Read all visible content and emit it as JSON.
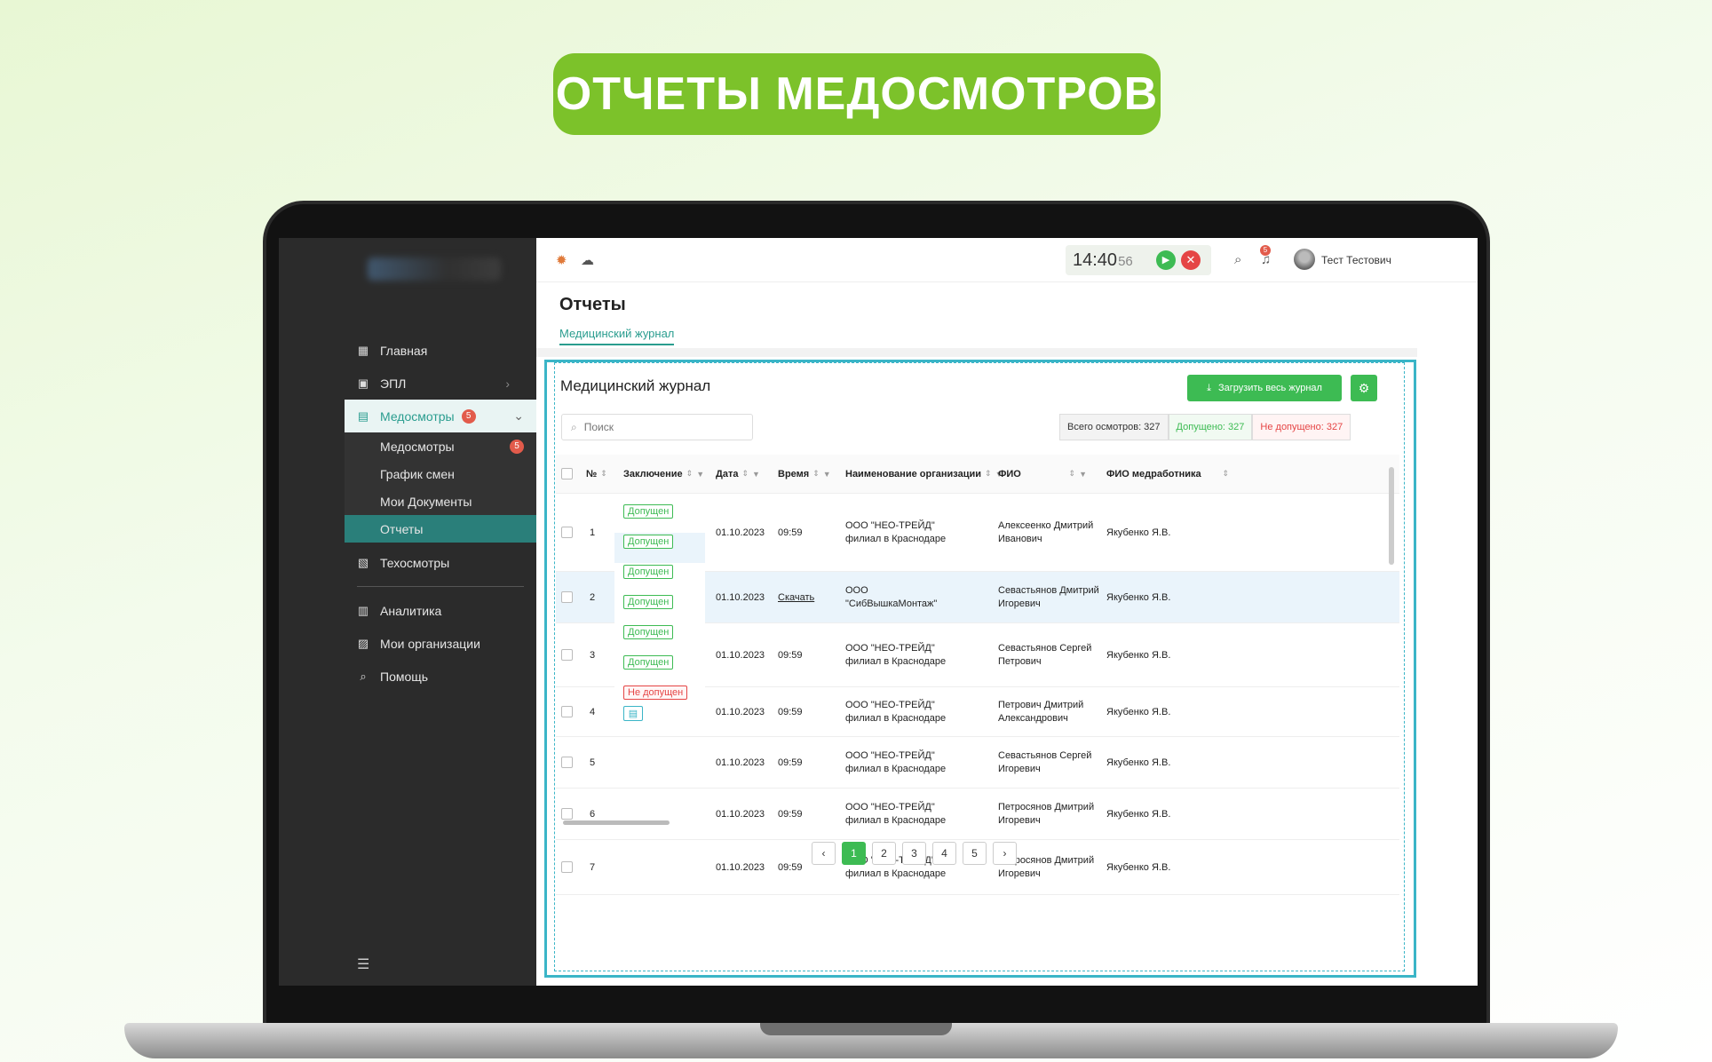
{
  "banner": {
    "title": "ОТЧЕТЫ МЕДОСМОТРОВ"
  },
  "sidebar": {
    "items": [
      {
        "label": "Главная",
        "icon": "grid-icon"
      },
      {
        "label": "ЭПЛ",
        "icon": "clipboard-icon"
      },
      {
        "label": "Медосмотры",
        "icon": "medical-doc-icon",
        "badge": "5"
      },
      {
        "label": "Техосмотры",
        "icon": "clipboard-check-icon"
      },
      {
        "label": "Аналитика",
        "icon": "analytics-icon"
      },
      {
        "label": "Мои организации",
        "icon": "building-icon"
      },
      {
        "label": "Помощь",
        "icon": "help-search-icon"
      }
    ],
    "submenu": [
      {
        "label": "Медосмотры",
        "badge": "5"
      },
      {
        "label": "График смен"
      },
      {
        "label": "Мои Документы"
      },
      {
        "label": "Отчеты"
      }
    ]
  },
  "topbar": {
    "clock_hm": "14:40",
    "clock_s": "56",
    "notifications": "5",
    "user": "Тест Тестович"
  },
  "page": {
    "title": "Отчеты",
    "tab": "Медицинский журнал",
    "card_title": "Медицинский журнал",
    "download_button": "Загрузить весь журнал",
    "search_placeholder": "Поиск",
    "stats": {
      "total": "Всего осмотров: 327",
      "allowed": "Допущено: 327",
      "denied": "Не допущено: 327"
    }
  },
  "table": {
    "columns": [
      "№",
      "Заключение",
      "Дата",
      "Время",
      "Наименование организации",
      "ФИО",
      "ФИО медработника"
    ],
    "tags": [
      "Допущен",
      "Допущен",
      "Допущен",
      "Допущен",
      "Допущен",
      "Допущен",
      "Не допущен"
    ],
    "rows": [
      {
        "n": "1",
        "date": "01.10.2023",
        "time": "09:59",
        "org1": "ООО \"НЕО-ТРЕЙД\"",
        "org2": "филиал в Краснодаре",
        "fio1": "Алексеенко Дмитрий",
        "fio2": "Иванович",
        "med": "Якубенко Я.В."
      },
      {
        "n": "2",
        "date": "01.10.2023",
        "time": "Скачать",
        "org1": "ООО",
        "org2": "\"СибВышкаМонтаж\"",
        "fio1": "Севастьянов Дмитрий",
        "fio2": "Игоревич",
        "med": "Якубенко Я.В."
      },
      {
        "n": "3",
        "date": "01.10.2023",
        "time": "09:59",
        "org1": "ООО \"НЕО-ТРЕЙД\"",
        "org2": "филиал в Краснодаре",
        "fio1": "Севастьянов Сергей",
        "fio2": "Петрович",
        "med": "Якубенко Я.В."
      },
      {
        "n": "4",
        "date": "01.10.2023",
        "time": "09:59",
        "org1": "ООО \"НЕО-ТРЕЙД\"",
        "org2": "филиал в Краснодаре",
        "fio1": "Петрович Дмитрий",
        "fio2": "Александрович",
        "med": "Якубенко Я.В."
      },
      {
        "n": "5",
        "date": "01.10.2023",
        "time": "09:59",
        "org1": "ООО \"НЕО-ТРЕЙД\"",
        "org2": "филиал в Краснодаре",
        "fio1": "Севастьянов Сергей",
        "fio2": "Игоревич",
        "med": "Якубенко Я.В."
      },
      {
        "n": "6",
        "date": "01.10.2023",
        "time": "09:59",
        "org1": "ООО \"НЕО-ТРЕЙД\"",
        "org2": "филиал в Краснодаре",
        "fio1": "Петросянов Дмитрий",
        "fio2": "Игоревич",
        "med": "Якубенко Я.В."
      },
      {
        "n": "7",
        "date": "01.10.2023",
        "time": "09:59",
        "org1": "ООО \"НЕО-ТРЕЙД\"",
        "org2": "филиал в Краснодаре",
        "fio1": "Петросянов Дмитрий",
        "fio2": "Игоревич",
        "med": "Якубенко Я.В."
      }
    ]
  },
  "pagination": {
    "pages": [
      "1",
      "2",
      "3",
      "4",
      "5"
    ],
    "current": "1"
  },
  "colors": {
    "accent": "#3dbb53",
    "brand_teal": "#2a9d8f",
    "banner": "#7cc22a",
    "danger": "#e54545"
  }
}
